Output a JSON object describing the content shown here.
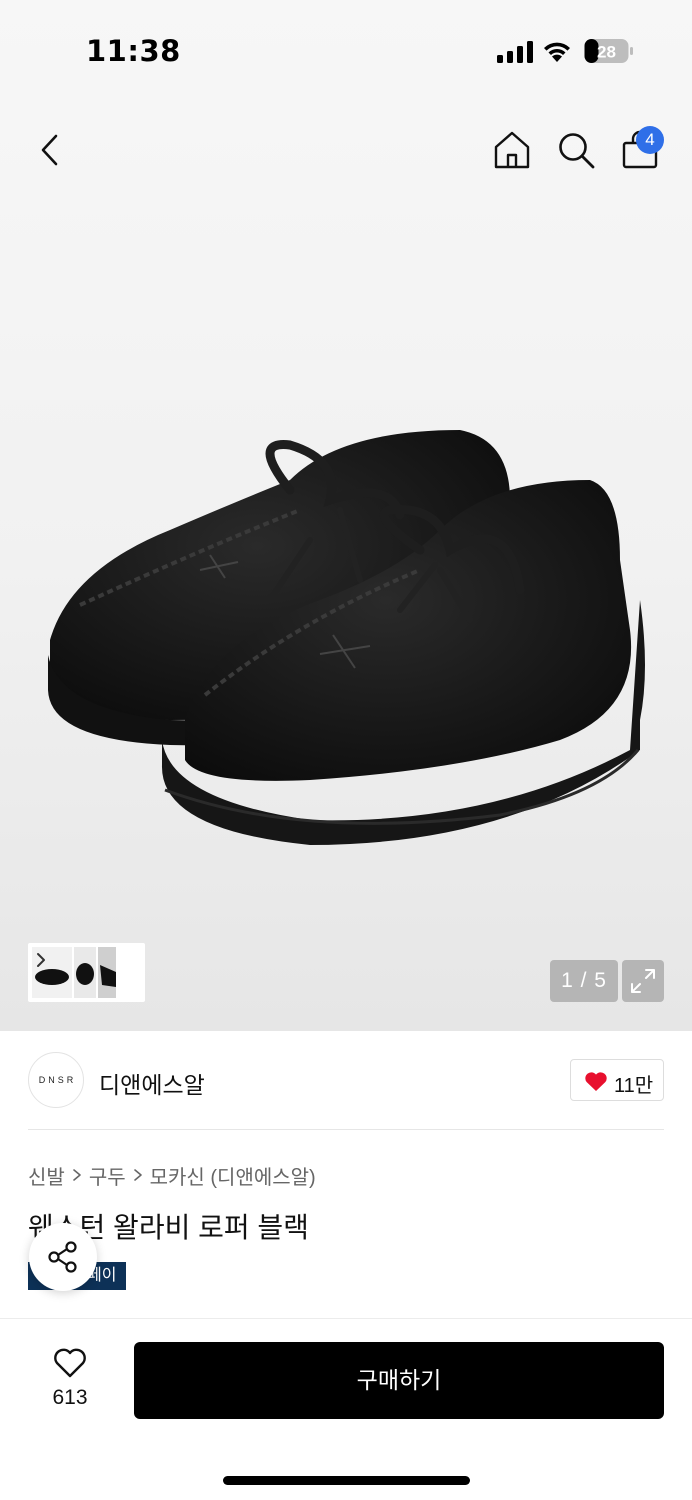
{
  "status_bar": {
    "time": "11:38",
    "battery_level": "28"
  },
  "nav": {
    "back_icon": "chevron-left-icon",
    "home_icon": "home-icon",
    "search_icon": "search-icon",
    "cart_icon": "shopping-bag-icon",
    "cart_count": "4"
  },
  "gallery": {
    "counter": "1 / 5",
    "expand_icon": "expand-icon",
    "thumb_arrow_icon": "chevron-right-icon"
  },
  "brand": {
    "logo_text": "DNSR",
    "name": "디앤에스알",
    "like_count": "11만",
    "heart_color": "#e8102e"
  },
  "breadcrumb": [
    "신발",
    "구두",
    "모카신 (디앤에스알)"
  ],
  "product": {
    "title": "웨스턴 왈라비 로퍼 블랙",
    "tag": "페이"
  },
  "bottom_bar": {
    "wish_count": "613",
    "buy_label": "구매하기"
  },
  "colors": {
    "cart_badge": "#2f6fe8",
    "tag_bg": "#0d3157",
    "buy_bg": "#000000"
  }
}
